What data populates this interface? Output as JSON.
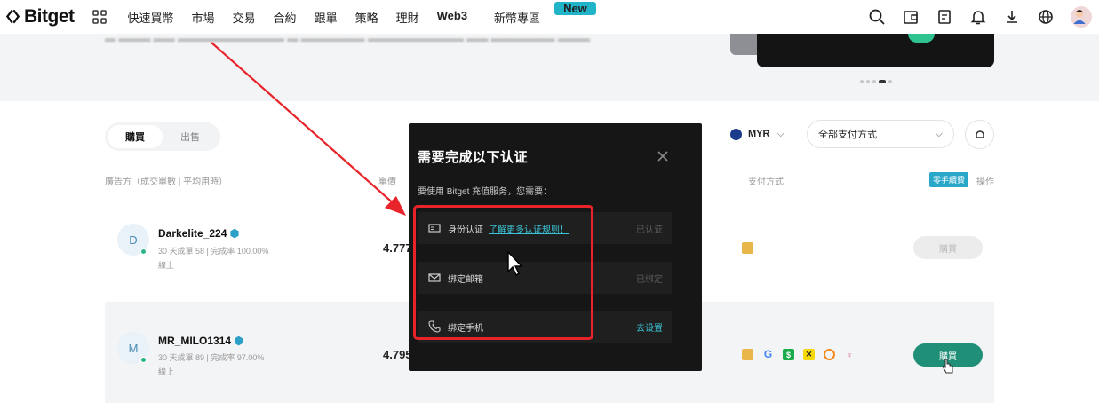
{
  "nav": {
    "logo_text": "Bitget",
    "menu": [
      "快速買幣",
      "市場",
      "交易",
      "合約",
      "跟單",
      "策略",
      "理財",
      "Web3",
      "新幣專區"
    ],
    "new_badge": "New",
    "icons": [
      "search-icon",
      "wallet-icon",
      "orders-icon",
      "bell-icon",
      "download-icon",
      "globe-icon",
      "avatar"
    ]
  },
  "filters": {
    "tab_buy": "購買",
    "tab_sell": "出售",
    "currency": "MYR",
    "payment": "全部支付方式"
  },
  "table": {
    "col_advertiser": "廣告方（成交單數 | 平均用時）",
    "col_price": "單價",
    "col_payment": "支付方式",
    "zero_fee_badge": "零手續費",
    "col_action": "操作",
    "rows": [
      {
        "initial": "D",
        "name": "Darkelite_224",
        "stats": "30 天成單 58 | 完成率 100.00%",
        "status": "線上",
        "price": "4.777",
        "button": "購買"
      },
      {
        "initial": "M",
        "name": "MR_MILO1314",
        "stats": "30 天成單 89 | 完成率 97.00%",
        "status": "線上",
        "price": "4.795",
        "button": "購買"
      }
    ]
  },
  "modal": {
    "title": "需要完成以下认证",
    "subtitle": "要使用 Bitget 充值服务，您需要：",
    "items": [
      {
        "label": "身份认证",
        "link": "了解更多认证规则！",
        "status": "已认证"
      },
      {
        "label": "绑定邮箱",
        "status": "已绑定"
      },
      {
        "label": "绑定手机",
        "status": "去设置"
      }
    ]
  },
  "colors": {
    "accent": "#1f8f77",
    "link": "#3bc4d6",
    "annotation": "#e8242a"
  }
}
